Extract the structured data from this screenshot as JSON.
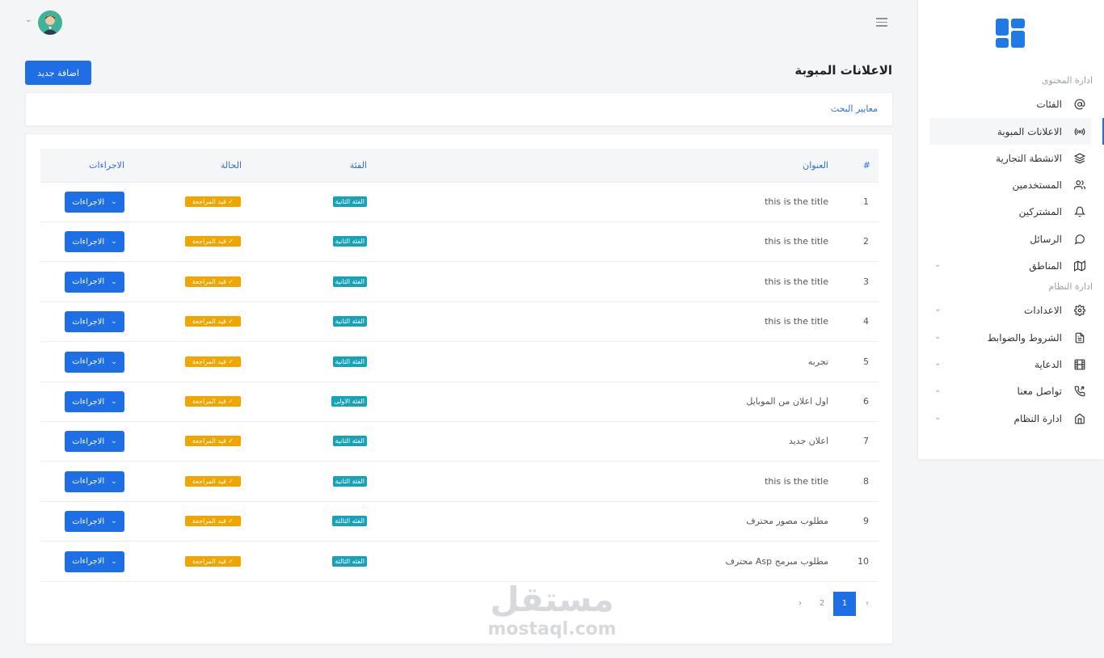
{
  "header": {
    "page_title": "الاعلانات المبوبة",
    "add_button": "اضافة جديد",
    "search_label": "معايير البحث"
  },
  "sidebar": {
    "section_content": "ادارة المحتوى",
    "section_system": "ادارة النظام",
    "items": [
      {
        "label": "الفئات",
        "icon": "at-icon"
      },
      {
        "label": "الاعلانات المبوبة",
        "icon": "broadcast-icon",
        "active": true
      },
      {
        "label": "الانشطة التجارية",
        "icon": "layers-icon"
      },
      {
        "label": "المستخدمين",
        "icon": "users-icon"
      },
      {
        "label": "المشتركين",
        "icon": "bell-icon"
      },
      {
        "label": "الرسائل",
        "icon": "message-icon"
      },
      {
        "label": "المناطق",
        "icon": "map-icon",
        "expandable": true
      },
      {
        "label": "الاعدادات",
        "icon": "gear-icon",
        "expandable": true
      },
      {
        "label": "الشروط والضوابط",
        "icon": "document-icon",
        "expandable": true
      },
      {
        "label": "الدعاية",
        "icon": "film-icon",
        "expandable": true
      },
      {
        "label": "تواصل معنا",
        "icon": "phone-icon",
        "expandable": true
      },
      {
        "label": "ادارة النظام",
        "icon": "home-icon",
        "expandable": true
      }
    ]
  },
  "table": {
    "headers": {
      "num": "#",
      "title": "العنوان",
      "category": "الفئة",
      "status": "الحالة",
      "actions": "الاجراءات"
    },
    "rows": [
      {
        "num": "1",
        "title": "this is the title",
        "category": "الفئة الثانية",
        "status": "✓ قيد المراجعة",
        "action": "الاجراءات"
      },
      {
        "num": "2",
        "title": "this is the title",
        "category": "الفئة الثانية",
        "status": "✓ قيد المراجعة",
        "action": "الاجراءات"
      },
      {
        "num": "3",
        "title": "this is the title",
        "category": "الفئة الثانية",
        "status": "✓ قيد المراجعة",
        "action": "الاجراءات"
      },
      {
        "num": "4",
        "title": "this is the title",
        "category": "الفئة الثانية",
        "status": "✓ قيد المراجعة",
        "action": "الاجراءات"
      },
      {
        "num": "5",
        "title": "تجربه",
        "category": "الفئة الثانية",
        "status": "✓ قيد المراجعة",
        "action": "الاجراءات"
      },
      {
        "num": "6",
        "title": "اول اعلان من الموبايل",
        "category": "الفئة الاولى",
        "status": "✓ قيد المراجعة",
        "action": "الاجراءات"
      },
      {
        "num": "7",
        "title": "اعلان جديد",
        "category": "الفئة الثانية",
        "status": "✓ قيد المراجعة",
        "action": "الاجراءات"
      },
      {
        "num": "8",
        "title": "this is the title",
        "category": "الفئة الثانية",
        "status": "✓ قيد المراجعة",
        "action": "الاجراءات"
      },
      {
        "num": "9",
        "title": "مطلوب مصور محترف",
        "category": "الفئه الثالثة",
        "status": "✓ قيد المراجعة",
        "action": "الاجراءات"
      },
      {
        "num": "10",
        "title": "مطلوب مبرمج Asp محترف",
        "category": "الفئه الثالثة",
        "status": "✓ قيد المراجعة",
        "action": "الاجراءات"
      }
    ]
  },
  "pagination": {
    "prev": "‹",
    "pages": [
      "1",
      "2"
    ],
    "current": "1",
    "next": "›"
  },
  "watermark": {
    "arabic": "مستقل",
    "latin": "mostaql.com"
  },
  "colors": {
    "primary": "#1e6ee6",
    "info": "#17a2b8",
    "warning": "#f0a500"
  }
}
